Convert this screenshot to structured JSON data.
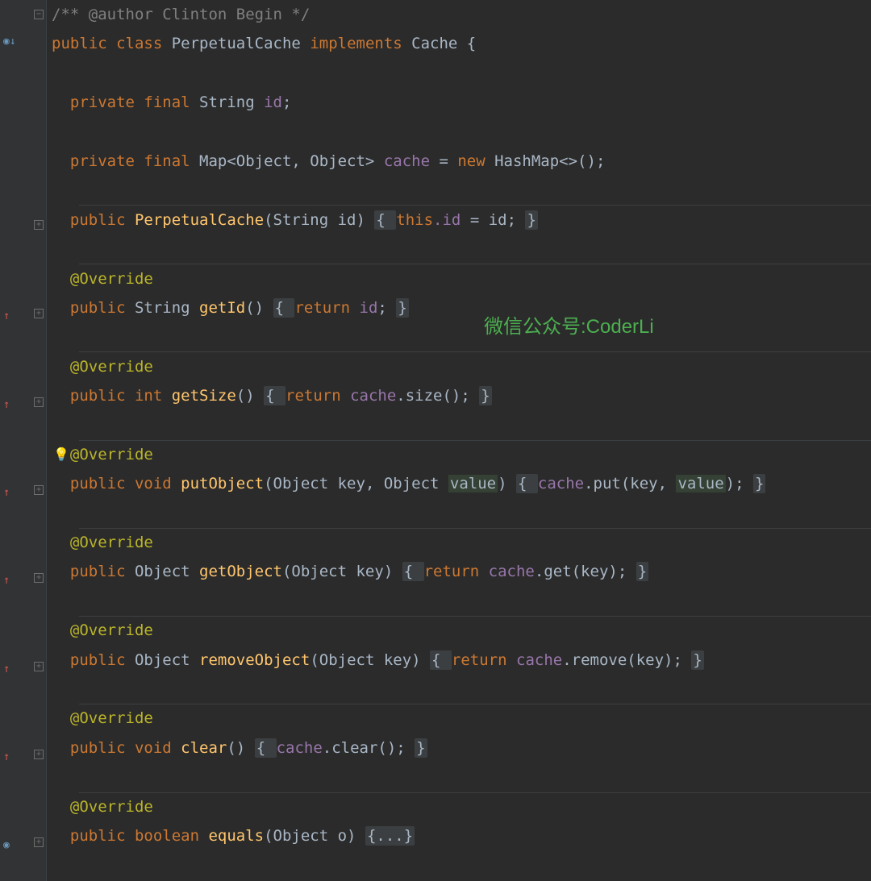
{
  "watermark": "微信公众号:CoderLi",
  "code": {
    "l0": "/** @author Clinton Begin */",
    "l1_public": "public ",
    "l1_class": "class ",
    "l1_name": "PerpetualCache ",
    "l1_impl": "implements ",
    "l1_iface": "Cache {",
    "l3": "  private final ",
    "l3_type": "String ",
    "l3_field": "id",
    "l3_end": ";",
    "l5": "  private final ",
    "l5_type": "Map<Object, Object> ",
    "l5_field": "cache ",
    "l5_eq": "= ",
    "l5_new": "new ",
    "l5_ctor": "HashMap<>();",
    "l7_public": "  public ",
    "l7_ctor": "PerpetualCache",
    "l7_params": "(String id) ",
    "l7_body_open": "{ ",
    "l7_this": "this",
    "l7_dotid": ".id ",
    "l7_eqid": "= id; ",
    "l7_close": "}",
    "anno": "  @Override",
    "l10_sig": "  public ",
    "l10_type": "String ",
    "l10_name": "getId",
    "l10_paren": "() ",
    "l10_open": "{ ",
    "l10_return": "return ",
    "l10_field": "id",
    "l10_end": "; ",
    "l10_close": "}",
    "l13_sig": "  public ",
    "l13_type": "int ",
    "l13_name": "getSize",
    "l13_paren": "() ",
    "l13_open": "{ ",
    "l13_return": "return ",
    "l13_field": "cache",
    "l13_call": ".size(); ",
    "l13_close": "}",
    "l16_sig": "  public ",
    "l16_void": "void ",
    "l16_name": "putObject",
    "l16_open_paren": "(Object key, Object ",
    "l16_value": "value",
    "l16_close_paren": ") ",
    "l16_open": "{ ",
    "l16_field": "cache",
    "l16_put": ".put(key, ",
    "l16_value2": "value",
    "l16_end": "); ",
    "l16_close": "}",
    "l19_sig": "  public ",
    "l19_type": "Object ",
    "l19_name": "getObject",
    "l19_params": "(Object key) ",
    "l19_open": "{ ",
    "l19_return": "return ",
    "l19_field": "cache",
    "l19_call": ".get(key); ",
    "l19_close": "}",
    "l22_sig": "  public ",
    "l22_type": "Object ",
    "l22_name": "removeObject",
    "l22_params": "(Object key) ",
    "l22_open": "{ ",
    "l22_return": "return ",
    "l22_field": "cache",
    "l22_call": ".remove(key); ",
    "l22_close": "}",
    "l25_sig": "  public ",
    "l25_void": "void ",
    "l25_name": "clear",
    "l25_paren": "() ",
    "l25_open": "{ ",
    "l25_field": "cache",
    "l25_call": ".clear(); ",
    "l25_close": "}",
    "l28_sig": "  public ",
    "l28_bool": "boolean ",
    "l28_name": "equals",
    "l28_params": "(Object o) ",
    "l28_fold": "{...}"
  }
}
